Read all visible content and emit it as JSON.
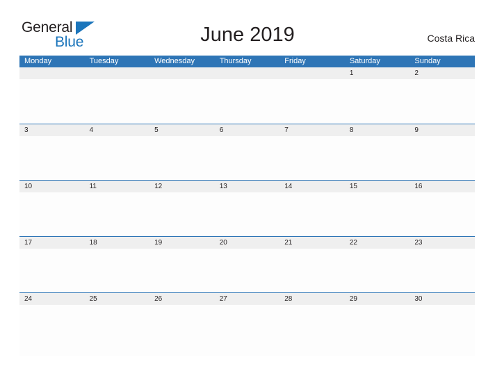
{
  "brand": {
    "name_part1": "General",
    "name_part2": "Blue",
    "colors": {
      "text": "#231f20",
      "blue": "#1b75bb"
    }
  },
  "header": {
    "title": "June 2019",
    "country": "Costa Rica"
  },
  "calendar": {
    "month": "June",
    "year": "2019",
    "colors": {
      "header_bg": "#2e75b6",
      "header_text": "#ffffff",
      "date_band_bg": "#efefef",
      "date_text": "#231f20",
      "cell_bg": "#fdfdfd",
      "rule": "#2e75b6"
    },
    "weekdays": [
      "Monday",
      "Tuesday",
      "Wednesday",
      "Thursday",
      "Friday",
      "Saturday",
      "Sunday"
    ],
    "weeks": [
      [
        "",
        "",
        "",
        "",
        "",
        "1",
        "2"
      ],
      [
        "3",
        "4",
        "5",
        "6",
        "7",
        "8",
        "9"
      ],
      [
        "10",
        "11",
        "12",
        "13",
        "14",
        "15",
        "16"
      ],
      [
        "17",
        "18",
        "19",
        "20",
        "21",
        "22",
        "23"
      ],
      [
        "24",
        "25",
        "26",
        "27",
        "28",
        "29",
        "30"
      ]
    ]
  }
}
